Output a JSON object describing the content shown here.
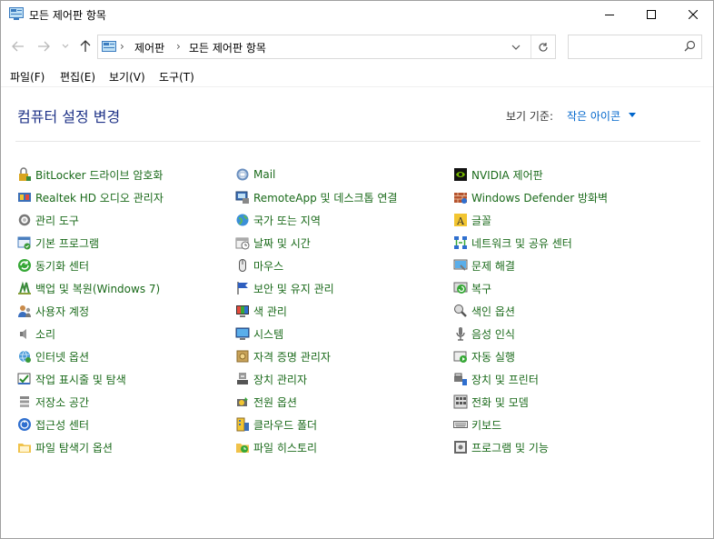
{
  "window": {
    "title": "모든 제어판 항목"
  },
  "address": {
    "crumbs": [
      "제어판",
      "모든 제어판 항목"
    ],
    "search_placeholder": ""
  },
  "menu": [
    "파일(F)",
    "편집(E)",
    "보기(V)",
    "도구(T)"
  ],
  "header": {
    "title": "컴퓨터 설정 변경",
    "view_by_label": "보기 기준:",
    "view_by_value": "작은 아이콘"
  },
  "columns": [
    [
      {
        "label": "BitLocker 드라이브 암호화",
        "icon": "bitlocker-icon"
      },
      {
        "label": "Realtek HD 오디오 관리자",
        "icon": "realtek-audio-icon"
      },
      {
        "label": "관리 도구",
        "icon": "admin-tools-icon"
      },
      {
        "label": "기본 프로그램",
        "icon": "default-programs-icon"
      },
      {
        "label": "동기화 센터",
        "icon": "sync-center-icon"
      },
      {
        "label": "백업 및 복원(Windows 7)",
        "icon": "backup-restore-icon"
      },
      {
        "label": "사용자 계정",
        "icon": "user-accounts-icon"
      },
      {
        "label": "소리",
        "icon": "sound-icon"
      },
      {
        "label": "인터넷 옵션",
        "icon": "internet-options-icon"
      },
      {
        "label": "작업 표시줄 및 탐색",
        "icon": "taskbar-icon"
      },
      {
        "label": "저장소 공간",
        "icon": "storage-spaces-icon"
      },
      {
        "label": "접근성 센터",
        "icon": "ease-of-access-icon"
      },
      {
        "label": "파일 탐색기 옵션",
        "icon": "file-explorer-options-icon"
      }
    ],
    [
      {
        "label": "Mail",
        "icon": "mail-icon"
      },
      {
        "label": "RemoteApp 및 데스크톱 연결",
        "icon": "remoteapp-icon"
      },
      {
        "label": "국가 또는 지역",
        "icon": "region-icon"
      },
      {
        "label": "날짜 및 시간",
        "icon": "date-time-icon"
      },
      {
        "label": "마우스",
        "icon": "mouse-icon"
      },
      {
        "label": "보안 및 유지 관리",
        "icon": "security-maintenance-icon"
      },
      {
        "label": "색 관리",
        "icon": "color-management-icon"
      },
      {
        "label": "시스템",
        "icon": "system-icon"
      },
      {
        "label": "자격 증명 관리자",
        "icon": "credential-manager-icon"
      },
      {
        "label": "장치 관리자",
        "icon": "device-manager-icon"
      },
      {
        "label": "전원 옵션",
        "icon": "power-options-icon"
      },
      {
        "label": "클라우드 폴더",
        "icon": "work-folders-icon"
      },
      {
        "label": "파일 히스토리",
        "icon": "file-history-icon"
      }
    ],
    [
      {
        "label": "NVIDIA 제어판",
        "icon": "nvidia-icon"
      },
      {
        "label": "Windows Defender 방화벽",
        "icon": "firewall-icon"
      },
      {
        "label": "글꼴",
        "icon": "fonts-icon"
      },
      {
        "label": "네트워크 및 공유 센터",
        "icon": "network-sharing-icon"
      },
      {
        "label": "문제 해결",
        "icon": "troubleshooting-icon"
      },
      {
        "label": "복구",
        "icon": "recovery-icon"
      },
      {
        "label": "색인 옵션",
        "icon": "indexing-options-icon"
      },
      {
        "label": "음성 인식",
        "icon": "speech-recognition-icon"
      },
      {
        "label": "자동 실행",
        "icon": "autoplay-icon"
      },
      {
        "label": "장치 및 프린터",
        "icon": "devices-printers-icon"
      },
      {
        "label": "전화 및 모뎀",
        "icon": "phone-modem-icon"
      },
      {
        "label": "키보드",
        "icon": "keyboard-icon"
      },
      {
        "label": "프로그램 및 기능",
        "icon": "programs-features-icon"
      }
    ]
  ]
}
